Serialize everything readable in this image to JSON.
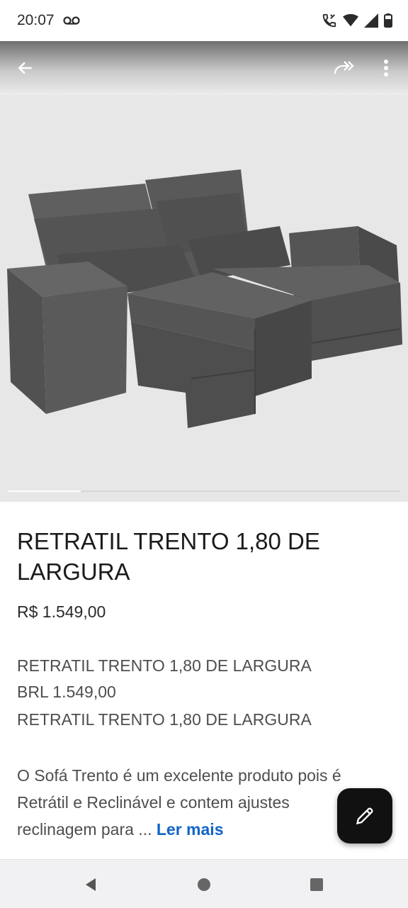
{
  "status": {
    "time": "20:07",
    "voicemail_icon": "voicemail-icon",
    "icons": [
      "wifi-calling-icon",
      "wifi-icon",
      "signal-icon",
      "battery-icon"
    ]
  },
  "header": {
    "back_icon": "arrow-back-icon",
    "share_icon": "share-icon",
    "more_icon": "more-vert-icon"
  },
  "product": {
    "image_alt": "sofa-image",
    "title": "RETRATIL TRENTO 1,80 DE LARGURA",
    "price": "R$ 1.549,00",
    "details": [
      "RETRATIL TRENTO 1,80 DE LARGURA",
      "BRL 1.549,00",
      "RETRATIL TRENTO 1,80 DE LARGURA"
    ],
    "description": "O Sofá Trento é um excelente produto pois é Retrátil e Reclinável e contem ajustes reclinagem para ...",
    "read_more": "Ler mais",
    "image_position": "1 of 6"
  },
  "fab": {
    "icon": "pencil-icon"
  },
  "nav": {
    "back_icon": "nav-back-icon",
    "home_icon": "nav-home-icon",
    "recents_icon": "nav-recents-icon"
  },
  "colors": {
    "accent": "#1264c8",
    "fab": "#111111",
    "sofa": "#5a5a5a"
  }
}
